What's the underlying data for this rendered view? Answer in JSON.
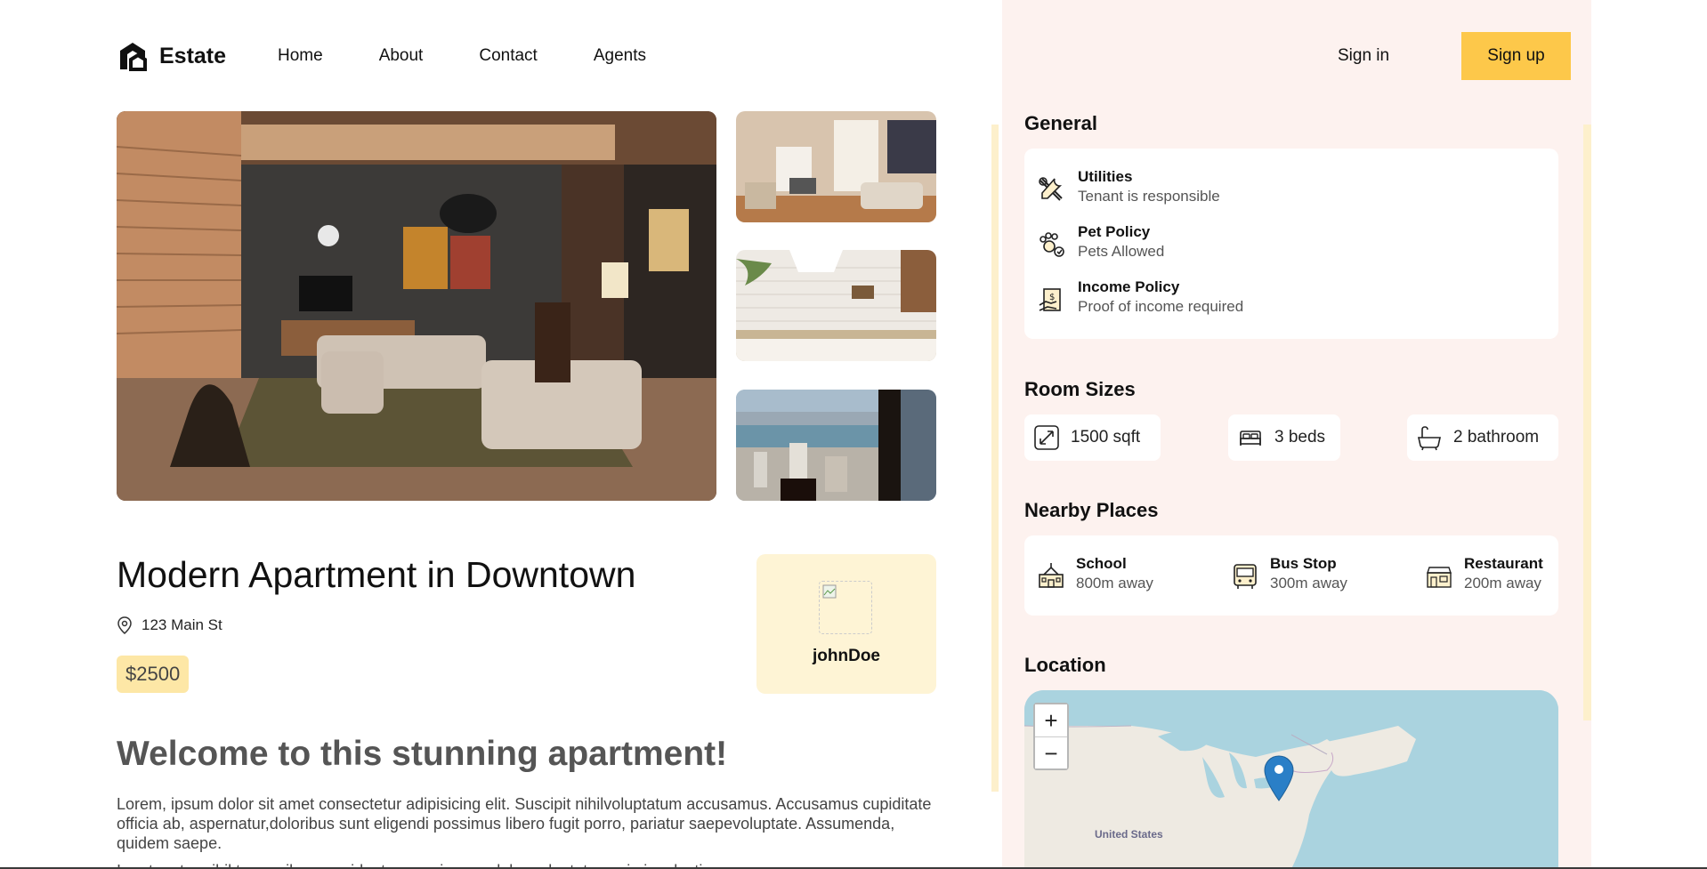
{
  "header": {
    "brand": "Estate",
    "nav": [
      "Home",
      "About",
      "Contact",
      "Agents"
    ],
    "sign_in": "Sign in",
    "sign_up": "Sign up"
  },
  "listing": {
    "title": "Modern Apartment in Downtown",
    "address": "123 Main St",
    "price": "$2500",
    "agent": "johnDoe",
    "welcome": "Welcome to this stunning apartment!",
    "description": "Lorem, ipsum dolor sit amet consectetur adipisicing elit. Suscipit nihilvoluptatum accusamus. Accusamus cupiditate officia ab, aspernatur,doloribus sunt eligendi possimus libero fugit porro, pariatur saepevoluptate. Assumenda, quidem saepe.",
    "description_more": "Iure tenetur nihil temporibus provident earum ipsam, dolor voluptates animi molestiae."
  },
  "general": {
    "title": "General",
    "items": [
      {
        "label": "Utilities",
        "value": "Tenant is responsible",
        "icon": "tools-icon"
      },
      {
        "label": "Pet Policy",
        "value": "Pets Allowed",
        "icon": "paw-icon"
      },
      {
        "label": "Income Policy",
        "value": "Proof of income required",
        "icon": "income-icon"
      }
    ]
  },
  "room_sizes": {
    "title": "Room Sizes",
    "size": "1500 sqft",
    "beds": "3 beds",
    "bathrooms": "2 bathroom"
  },
  "nearby": {
    "title": "Nearby Places",
    "items": [
      {
        "label": "School",
        "value": "800m away",
        "icon": "school-icon"
      },
      {
        "label": "Bus Stop",
        "value": "300m away",
        "icon": "bus-icon"
      },
      {
        "label": "Restaurant",
        "value": "200m away",
        "icon": "restaurant-icon"
      }
    ]
  },
  "location": {
    "title": "Location",
    "zoom_in": "+",
    "zoom_out": "−",
    "map_label": "United States"
  },
  "colors": {
    "accent": "#fdc84a",
    "panel_bg": "#fdf2ef",
    "card_bg": "#fef4d5"
  }
}
